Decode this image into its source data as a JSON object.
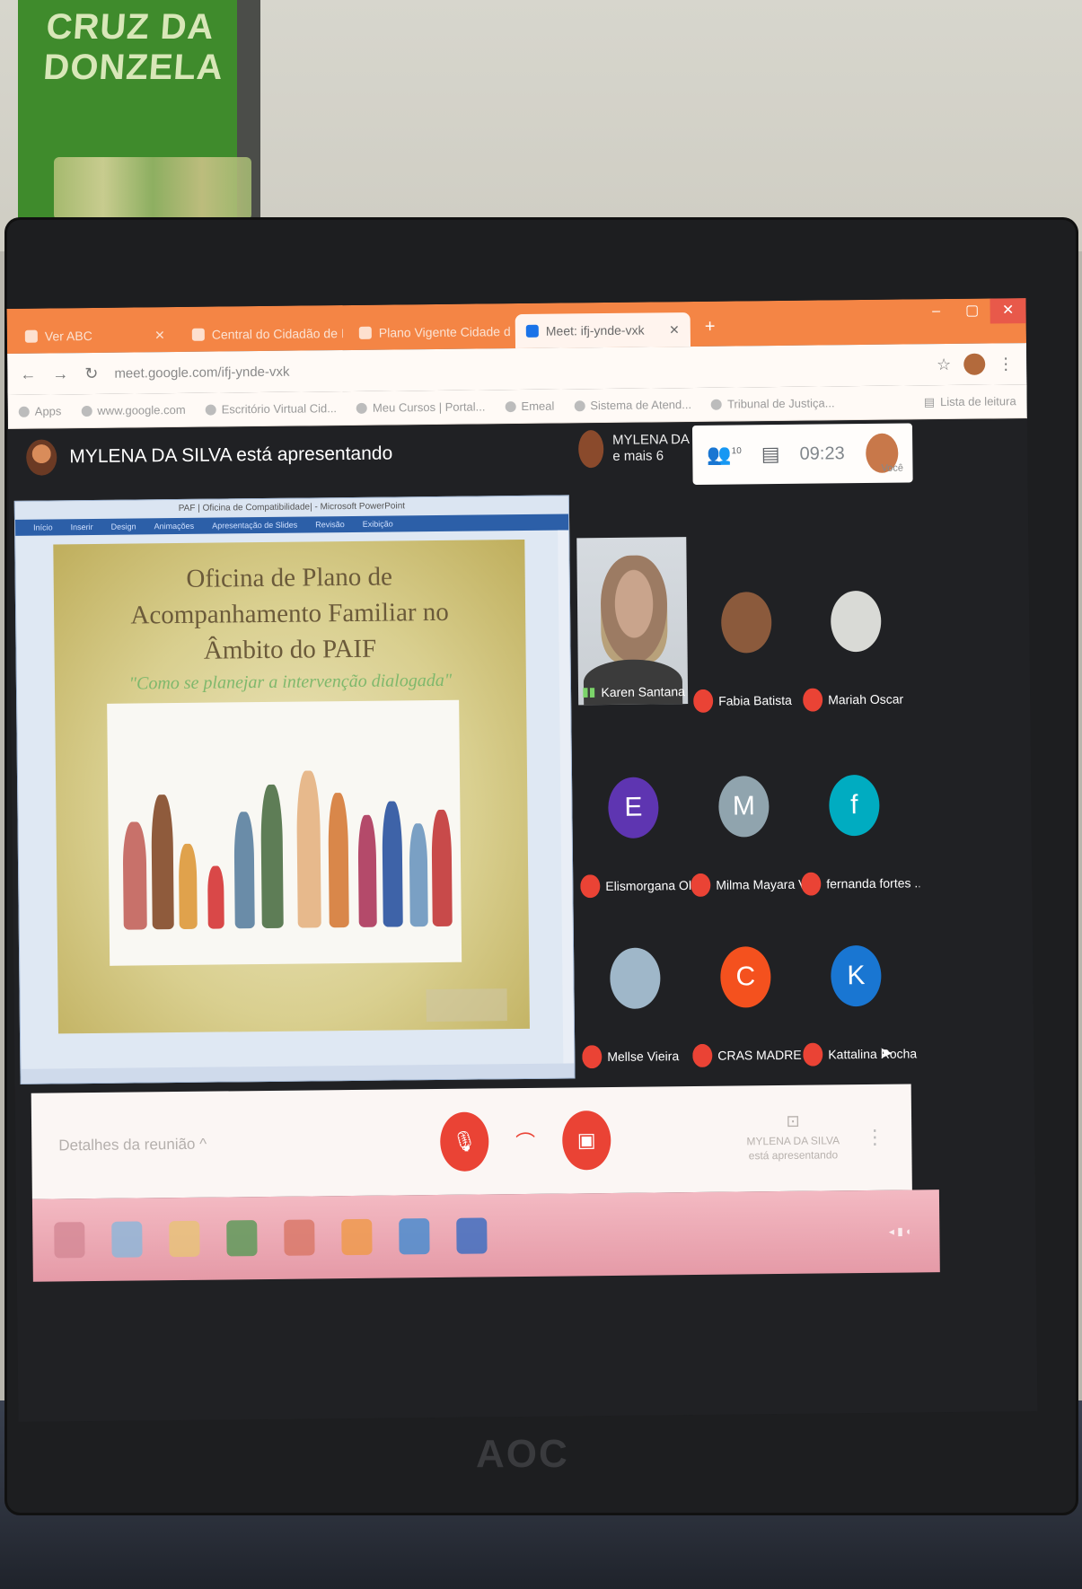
{
  "wall_poster": {
    "text": "CRUZ DA DONZELA"
  },
  "monitor": {
    "brand": "AOC"
  },
  "browser": {
    "tabs": [
      {
        "label": "Ver ABC",
        "active": false
      },
      {
        "label": "Central do Cidadão de Inscrição",
        "active": false
      },
      {
        "label": "Plano Vigente Cidade de Cruz",
        "active": false
      },
      {
        "label": "Meet: ifj-ynde-vxk",
        "active": true
      }
    ],
    "url": "meet.google.com/ifj-ynde-vxk",
    "bookmarks": [
      "Apps",
      "www.google.com",
      "Escritório Virtual Cid...",
      "Meu Cursos | Portal...",
      "Emeal",
      "Sistema de Atend...",
      "Tribunal de Justiça..."
    ],
    "reading_list": "Lista de leitura"
  },
  "meet": {
    "presenter_banner": "MYLENA DA SILVA está apresentando",
    "presenter_mini_name": "MYLENA DA SIL...",
    "presenter_mini_more": "e mais 6",
    "participant_count": "10",
    "time": "09:23",
    "you_label": "Você",
    "details_label": "Detalhes da reunião",
    "present_label_1": "MYLENA DA SILVA",
    "present_label_2": "está apresentando"
  },
  "slide": {
    "window_title": "PAF | Oficina de Compatibilidade| - Microsoft PowerPoint",
    "ribbon": [
      "Início",
      "Inserir",
      "Design",
      "Animações",
      "Apresentação de Slides",
      "Revisão",
      "Exibição"
    ],
    "title_line1": "Oficina de Plano de",
    "title_line2": "Acompanhamento Familiar no",
    "title_line3": "Âmbito do   PAIF",
    "subtitle": "\"Como se planejar a intervenção dialogada\""
  },
  "participants": [
    {
      "name": "Karen Santana",
      "type": "video"
    },
    {
      "name": "Fabia Batista",
      "initial": "",
      "color": "#8b5a3c",
      "muted": true
    },
    {
      "name": "Mariah Oscar",
      "initial": "",
      "color": "#d9dad6",
      "muted": true
    },
    {
      "name": "Elismorgana Oliv...",
      "initial": "E",
      "color": "#5e35b1",
      "muted": true
    },
    {
      "name": "Milma Mayara Vil...",
      "initial": "M",
      "color": "#90a4ae",
      "muted": true
    },
    {
      "name": "fernanda fortes ...",
      "initial": "f",
      "color": "#00acc1",
      "muted": true
    },
    {
      "name": "Mellse Vieira",
      "initial": "",
      "color": "#9fb7c9",
      "muted": true
    },
    {
      "name": "CRAS MADRE TE...",
      "initial": "C",
      "color": "#f4511e",
      "muted": true
    },
    {
      "name": "Kattalina Rocha",
      "initial": "K",
      "color": "#1976d2",
      "muted": true
    }
  ],
  "colors": {
    "tab_orange": "#f48545",
    "meet_bg": "#202124",
    "mute_red": "#ea4335",
    "taskbar_pink": "#e59aa7"
  }
}
